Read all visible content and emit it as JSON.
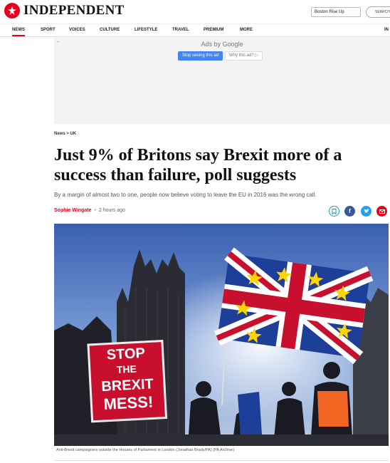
{
  "header": {
    "logo_text": "INDEPENDENT",
    "promo_label": "Boston Rise Up",
    "search_label": "SEARCH",
    "brand_color": "#e5001c"
  },
  "nav": {
    "items": [
      "NEWS",
      "SPORT",
      "VOICES",
      "CULTURE",
      "LIFESTYLE",
      "TRAVEL",
      "PREMIUM",
      "MORE"
    ],
    "active": "NEWS",
    "right_label": "IN"
  },
  "ad": {
    "back_arrow": "←",
    "title": "Ads by Google",
    "stop_label": "Stop seeing this ad",
    "why_label": "Why this ad? ▷"
  },
  "article": {
    "breadcrumb": "News > UK",
    "headline": "Just 9% of Britons say Brexit more of a success than failure, poll suggests",
    "standfirst": "By a margin of almost two to one, people now believe voting to leave the EU in 2016 was the wrong call.",
    "author": "Sophie Wingate",
    "separator": "•",
    "time": "2 hours ago",
    "share_icons": [
      "bookmark-icon",
      "facebook-icon",
      "twitter-icon",
      "email-icon"
    ],
    "share_colors": [
      "#1a9ba8",
      "#3b5998",
      "#1da1f2",
      "#e5001c"
    ],
    "placard": {
      "line1": "STOP",
      "line2": "THE",
      "line3": "BREXIT",
      "line4": "MESS!"
    },
    "caption": "Anti-Brexit campaigners outside the Houses of Parliament in London (Jonathan Brady/PA) (PA Archive)"
  }
}
